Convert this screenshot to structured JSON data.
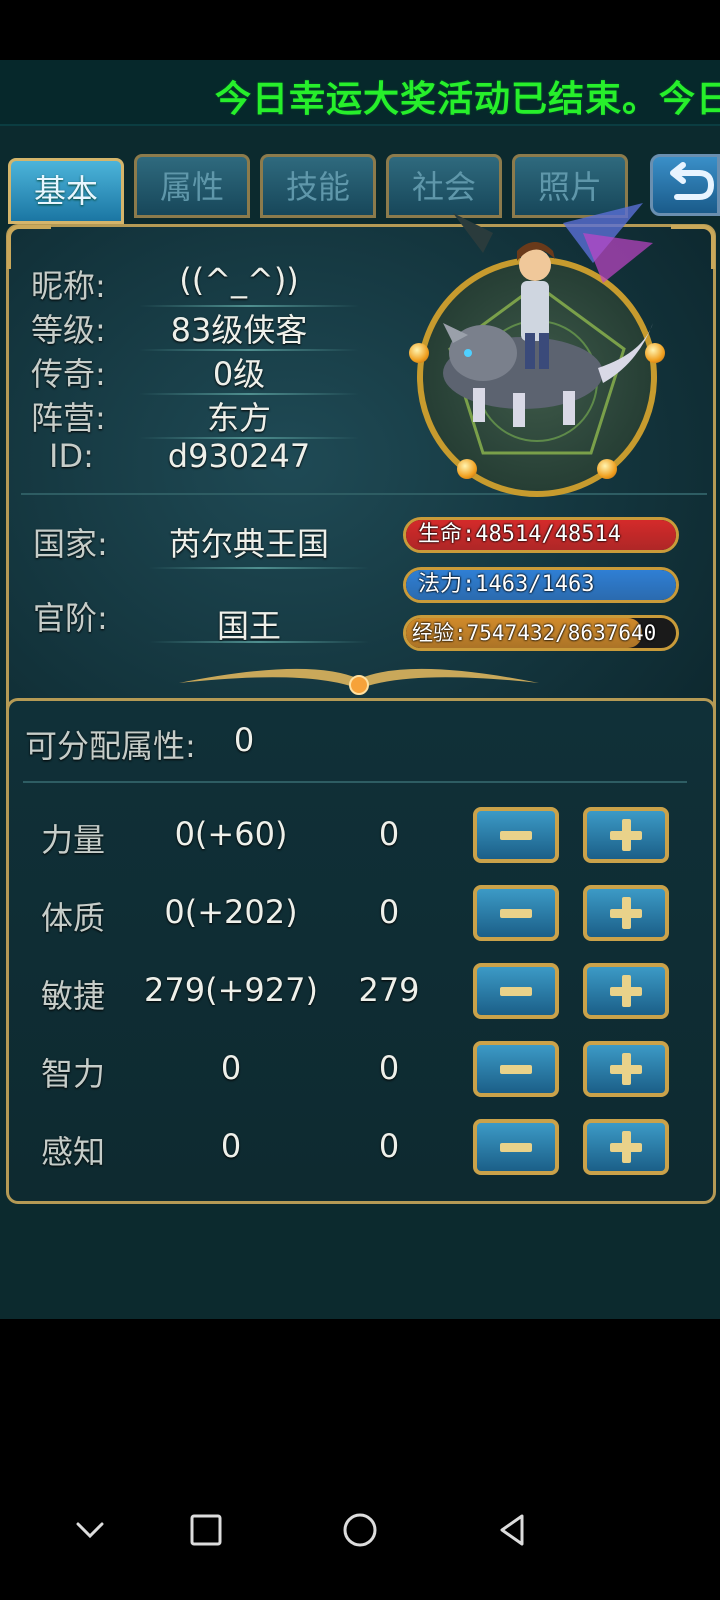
{
  "ticker": {
    "text": "今日幸运大奖活动已结束。今日"
  },
  "tabs": [
    {
      "label": "基本",
      "active": true
    },
    {
      "label": "属性",
      "active": false
    },
    {
      "label": "技能",
      "active": false
    },
    {
      "label": "社会",
      "active": false
    },
    {
      "label": "照片",
      "active": false
    }
  ],
  "back_icon": "return-arrow-icon",
  "profile": {
    "nickname_label": "昵称:",
    "nickname": "((^_^))",
    "level_label": "等级:",
    "level": "83级侠客",
    "legend_label": "传奇:",
    "legend": "0级",
    "camp_label": "阵营:",
    "camp": "东方",
    "id_label": "ID:",
    "id": "d930247",
    "country_label": "国家:",
    "country": "芮尔典王国",
    "rank_label": "官阶:",
    "rank": "国王"
  },
  "stats": {
    "hp": {
      "text": "生命:48514/48514",
      "fill": 1.0,
      "color": "#d42a2a"
    },
    "mp": {
      "text": "法力:1463/1463",
      "fill": 1.0,
      "color": "#2f7fd4"
    },
    "exp": {
      "text": "经验:7547432/8637640",
      "fill": 0.874,
      "color": "#d08a2a"
    }
  },
  "attributes": {
    "points_label": "可分配属性:",
    "points_value": "0",
    "rows": [
      {
        "name": "力量",
        "base": "0(+60)",
        "current": "0"
      },
      {
        "name": "体质",
        "base": "0(+202)",
        "current": "0"
      },
      {
        "name": "敏捷",
        "base": "279(+927)",
        "current": "279"
      },
      {
        "name": "智力",
        "base": "0",
        "current": "0"
      },
      {
        "name": "感知",
        "base": "0",
        "current": "0"
      }
    ]
  },
  "nav": {
    "icons": [
      "chevron-down-icon",
      "square-recents-icon",
      "circle-home-icon",
      "triangle-back-icon"
    ]
  }
}
